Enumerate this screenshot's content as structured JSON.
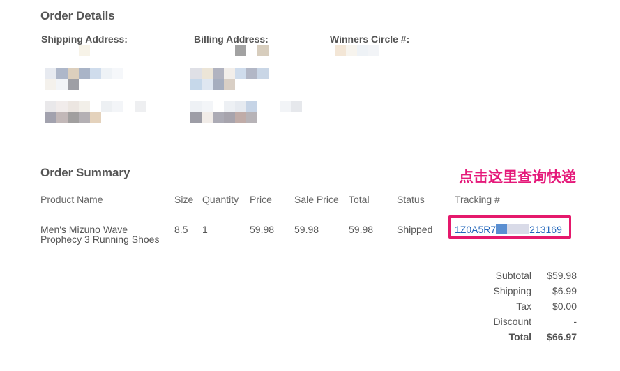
{
  "order_details": {
    "title": "Order Details",
    "shipping_label": "Shipping Address:",
    "billing_label": "Billing Address:",
    "winners_label": "Winners Circle #:"
  },
  "order_summary": {
    "title": "Order Summary",
    "columns": [
      "Product Name",
      "Size",
      "Quantity",
      "Price",
      "Sale Price",
      "Total",
      "Status",
      "Tracking #"
    ],
    "row": {
      "product_line1": "Men's Mizuno Wave",
      "product_line2": "Prophecy 3 Running Shoes",
      "size": "8.5",
      "quantity": "1",
      "price": "59.98",
      "sale_price": "59.98",
      "total": "59.98",
      "status": "Shipped",
      "tracking_prefix": "1Z0A5R7",
      "tracking_suffix": "213169"
    }
  },
  "totals": {
    "subtotal_label": "Subtotal",
    "subtotal": "$59.98",
    "shipping_label": "Shipping",
    "shipping": "$6.99",
    "tax_label": "Tax",
    "tax": "$0.00",
    "discount_label": "Discount",
    "discount": "-",
    "total_label": "Total",
    "total": "$66.97"
  },
  "annotation": {
    "text": "点击这里查询快递",
    "color": "#e5197a"
  },
  "colors": {
    "link": "#2266bb",
    "highlight_border": "#e5196c",
    "text": "#555555"
  }
}
